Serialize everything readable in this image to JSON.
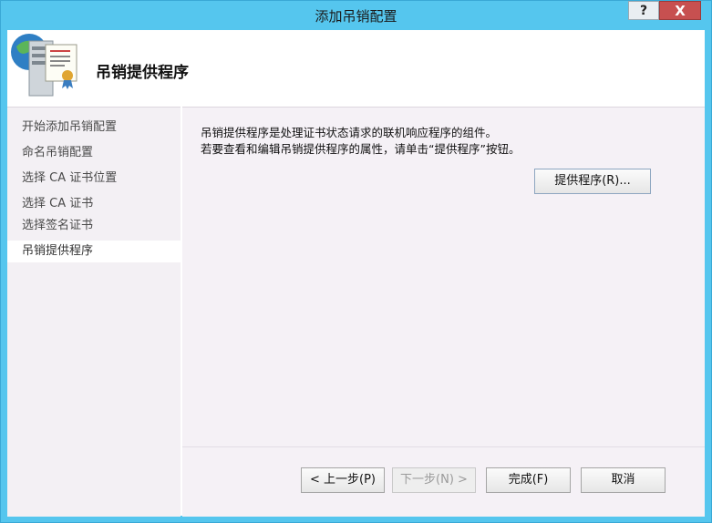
{
  "window": {
    "title": "添加吊销配置",
    "help_label": "?",
    "close_label": "X"
  },
  "header": {
    "title": "吊销提供程序"
  },
  "sidebar": {
    "items": [
      {
        "label": "开始添加吊销配置"
      },
      {
        "label": "命名吊销配置"
      },
      {
        "label": "选择 CA 证书位置"
      },
      {
        "label": "选择 CA 证书"
      },
      {
        "label": "选择签名证书"
      },
      {
        "label": "吊销提供程序",
        "active": true
      }
    ]
  },
  "main": {
    "description_line1": "吊销提供程序是处理证书状态请求的联机响应程序的组件。",
    "description_line2": "若要查看和编辑吊销提供程序的属性，请单击“提供程序”按钮。",
    "provider_button": "提供程序(R)..."
  },
  "footer": {
    "back_label": "< 上一步(P)",
    "next_label": "下一步(N) >",
    "finish_label": "完成(F)",
    "cancel_label": "取消"
  },
  "colors": {
    "titlebar": "#55c6ee",
    "close": "#c75050",
    "sidebar_bg": "#f3f0f4",
    "main_bg": "#f5f1f6"
  }
}
